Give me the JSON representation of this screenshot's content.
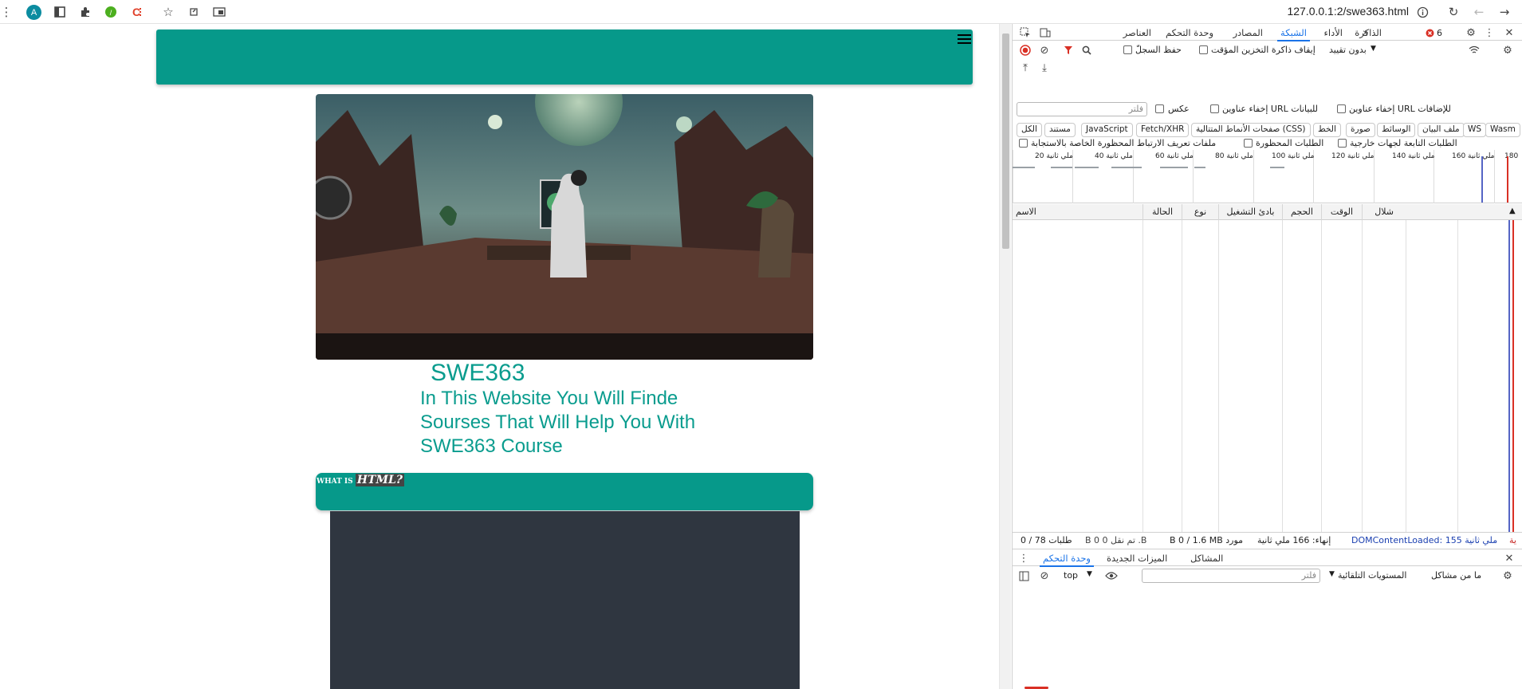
{
  "browser": {
    "url": "127.0.0.1:2/swe363.html",
    "profile_initial": "A"
  },
  "page": {
    "course_title": "SWE363",
    "course_description": "In This Website You Will Finde Sourses That Will Help You With SWE363 Course",
    "html_question_prefix": "WHAT IS",
    "html_question_keyword": "HTML?",
    "colors": {
      "accent": "#06998a",
      "text_accent": "#0a9c8e",
      "dark_block": "#2f3640"
    }
  },
  "devtools": {
    "tabs": {
      "elements": "العناصر",
      "console": "وحدة التحكم",
      "sources": "المصادر",
      "network": "الشبكة",
      "performance": "الأداء",
      "memory": "الذاكرة"
    },
    "issues_count": "6",
    "network": {
      "preserve_log": "حفظ السجلّ",
      "disable_cache": "إيقاف ذاكرة التخزين المؤقت",
      "throttling": "بدون تقييد",
      "filter_placeholder": "فلتر",
      "invert": "عكس",
      "hide_data_urls": "إخفاء عناوين URL للبيانات",
      "hide_extension_urls": "إخفاء عناوين URL للإضافات",
      "type_filters": [
        "الكل",
        "مستند",
        "JavaScript",
        "Fetch/XHR",
        "صفحات الأنماط المتتالية (CSS)",
        "الخط",
        "صورة",
        "الوسائط",
        "ملف البيان",
        "WS",
        "Wasm"
      ],
      "blocked_cookies": "ملفات تعريف الارتباط المحظورة الخاصة بالاستجابة",
      "blocked_requests": "الطلبات المحظورة",
      "third_party": "الطلبات التابعة لجهات خارجية",
      "timeline_ticks": [
        "20 ملي ثانية",
        "40 ملي ثانية",
        "60 ملي ثانية",
        "80 ملي ثانية",
        "100 ملي ثانية",
        "120 ملي ثانية",
        "140 ملي ثانية",
        "160 ملي ثانية",
        "180"
      ],
      "columns": {
        "name": "الاسم",
        "status": "الحالة",
        "type": "نوع",
        "initiator": "بادئ التشغيل",
        "size": "الحجم",
        "time": "الوقت",
        "waterfall": "شلال"
      },
      "status_bar": {
        "requests": "طلبات 78 / 0",
        "transferred": "B 0 تم نقل 0 .B",
        "resources": "B 0 / 1.6 MB مورد",
        "finish": "إنهاء: 166 ملي ثانية",
        "dcl": "DOMContentLoaded: 155 ملي ثانية",
        "load_partial": "ية"
      }
    },
    "drawer": {
      "console_tab": "وحدة التحكم",
      "whats_new_tab": "الميزات الجديدة",
      "issues_tab": "المشاكل",
      "context": "top",
      "filter_placeholder": "فلتر",
      "levels": "المستويات التلقائية",
      "no_issues": "ما من مشاكل"
    }
  }
}
